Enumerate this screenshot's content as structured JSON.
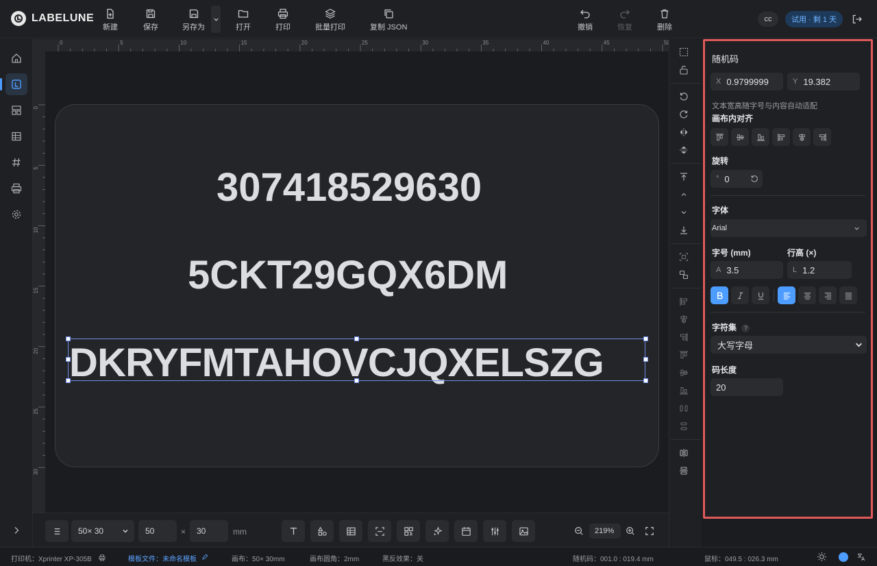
{
  "app": {
    "name": "LABELUNE"
  },
  "toolbar": {
    "new": "新建",
    "save": "保存",
    "save_as": "另存为",
    "open": "打开",
    "print": "打印",
    "batch_print": "批量打印",
    "copy_json": "复制 JSON",
    "undo": "撤销",
    "redo": "恢复",
    "delete": "删除"
  },
  "header": {
    "user": "cc",
    "trial": "试用 · 剩 1 天"
  },
  "ruler": {
    "h": [
      "0",
      "5",
      "10",
      "15",
      "20",
      "25",
      "30",
      "35",
      "40",
      "45",
      "50"
    ],
    "v": [
      "0",
      "5",
      "10",
      "15",
      "20",
      "25",
      "30"
    ]
  },
  "canvas": {
    "line1": "307418529630",
    "line2": "5CKT29GQX6DM",
    "line3": "DKRYFMTAHOVCJQXELSZG"
  },
  "bottom": {
    "size_preset": "50× 30",
    "width": "50",
    "times": "×",
    "height": "30",
    "unit": "mm",
    "zoom": "219%"
  },
  "panel": {
    "title": "随机码",
    "x_prefix": "X",
    "x_value": "0.9799999",
    "y_prefix": "Y",
    "y_value": "19.382",
    "auto_fit_note": "文本宽高随字号与内容自动适配",
    "align_label": "画布内对齐",
    "rotate_label": "旋转",
    "rotate_prefix": "°",
    "rotate_value": "0",
    "font_label": "字体",
    "font_value": "Arial",
    "font_size_label": "字号 (mm)",
    "line_height_label": "行高 (×)",
    "font_size_prefix": "A",
    "font_size_value": "3.5",
    "line_height_prefix": "L",
    "line_height_value": "1.2",
    "charset_label": "字符集",
    "charset_help": "?",
    "charset_value": "大写字母",
    "length_label": "码长度",
    "length_value": "20"
  },
  "status": {
    "printer": "打印机：Xprinter XP-305B",
    "template_prefix": "模板文件：",
    "template_name": "未命名模板",
    "canvas": "画布：50× 30mm",
    "corner": "画布圆角：2mm",
    "invert": "黑反效果：关",
    "random_code": "随机码：001.0 : 019.4 mm",
    "mouse": "鼠标：049.5 : 026.3 mm"
  },
  "colors": {
    "accent": "#4c9dff",
    "highlight_border": "#e05a5a",
    "selection": "#6f8fe8"
  }
}
